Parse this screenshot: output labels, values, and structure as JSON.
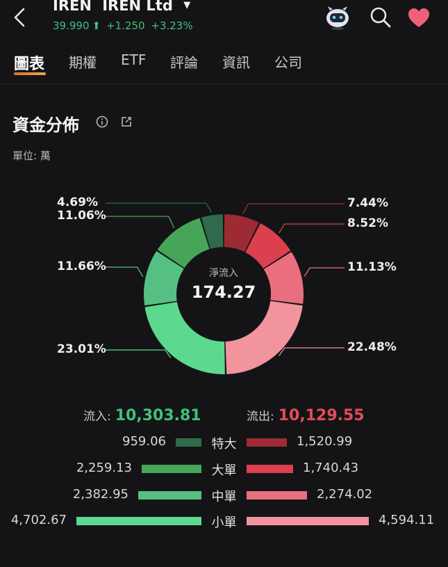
{
  "header": {
    "ticker_symbol": "IREN",
    "ticker_name": "IREN Ltd",
    "price": "39.990",
    "price_arrow": "⬆",
    "change": "+1.250",
    "change_pct": "+3.23%",
    "accent_up": "#3ec27a",
    "icons": [
      "back-arrow-icon",
      "robot-assistant-icon",
      "search-icon",
      "heart-icon"
    ]
  },
  "tabs": [
    {
      "label": "圖表",
      "active": true
    },
    {
      "label": "期權",
      "active": false
    },
    {
      "label": "ETF",
      "active": false
    },
    {
      "label": "評論",
      "active": false
    },
    {
      "label": "資訊",
      "active": false
    },
    {
      "label": "公司",
      "active": false
    }
  ],
  "section": {
    "title": "資金分佈",
    "unit_label": "單位: 萬"
  },
  "chart_data": {
    "type": "pie",
    "center_label": "淨流入",
    "center_value": "174.27",
    "slices": [
      {
        "group": "outflow",
        "category": "特大",
        "percent": 7.44,
        "label": "7.44%",
        "color": "#9e2b34"
      },
      {
        "group": "outflow",
        "category": "大單",
        "percent": 8.52,
        "label": "8.52%",
        "color": "#dc3f4d"
      },
      {
        "group": "outflow",
        "category": "中單",
        "percent": 11.13,
        "label": "11.13%",
        "color": "#ea6f7e"
      },
      {
        "group": "outflow",
        "category": "小單",
        "percent": 22.48,
        "label": "22.48%",
        "color": "#f2949e"
      },
      {
        "group": "inflow",
        "category": "小單",
        "percent": 23.01,
        "label": "23.01%",
        "color": "#5dd88f"
      },
      {
        "group": "inflow",
        "category": "中單",
        "percent": 11.66,
        "label": "11.66%",
        "color": "#55c082"
      },
      {
        "group": "inflow",
        "category": "大單",
        "percent": 11.06,
        "label": "11.06%",
        "color": "#47a55a"
      },
      {
        "group": "inflow",
        "category": "特大",
        "percent": 4.69,
        "label": "4.69%",
        "color": "#2f6b4a"
      }
    ]
  },
  "totals": {
    "inflow_label": "流入:",
    "inflow_value": "10,303.81",
    "outflow_label": "流出:",
    "outflow_value": "10,129.55"
  },
  "breakdown": [
    {
      "label": "特大",
      "inflow": "959.06",
      "inflow_num": 959.06,
      "outflow": "1,520.99",
      "outflow_num": 1520.99,
      "in_color": "#2f6b4a",
      "out_color": "#9e2b34"
    },
    {
      "label": "大單",
      "inflow": "2,259.13",
      "inflow_num": 2259.13,
      "outflow": "1,740.43",
      "outflow_num": 1740.43,
      "in_color": "#47a55a",
      "out_color": "#dc3f4d"
    },
    {
      "label": "中單",
      "inflow": "2,382.95",
      "inflow_num": 2382.95,
      "outflow": "2,274.02",
      "outflow_num": 2274.02,
      "in_color": "#55c082",
      "out_color": "#ea6f7e"
    },
    {
      "label": "小單",
      "inflow": "4,702.67",
      "inflow_num": 4702.67,
      "outflow": "4,594.11",
      "outflow_num": 4594.11,
      "in_color": "#5dd88f",
      "out_color": "#f2949e"
    }
  ]
}
